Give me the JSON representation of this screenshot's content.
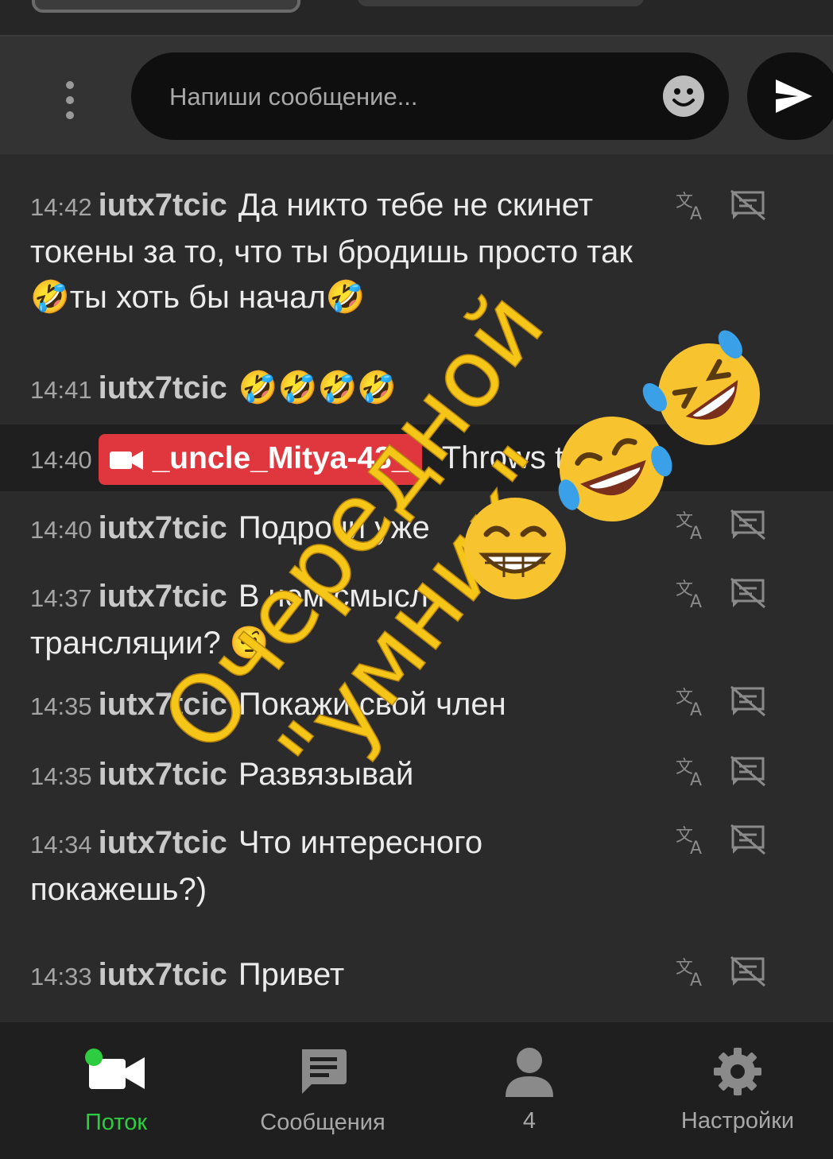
{
  "composer": {
    "placeholder": "Напиши сообщение..."
  },
  "messages": [
    {
      "time": "14:42",
      "user": "iutx7tcic",
      "text": "Да никто тебе не скинет токены за то, что ты бродишь просто так🤣ты хоть бы начал🤣"
    },
    {
      "time": "14:41",
      "user": "iutx7tcic",
      "text": "🤣🤣🤣🤣"
    },
    {
      "time": "14:40",
      "user": "_uncle_Mitya-43_",
      "text": "Throws tokens"
    },
    {
      "time": "14:40",
      "user": "iutx7tcic",
      "text": "Подрочи уже"
    },
    {
      "time": "14:37",
      "user": "iutx7tcic",
      "text": "В чем смысл трансляции? 🤨"
    },
    {
      "time": "14:35",
      "user": "iutx7tcic",
      "text": "Покажи свой член"
    },
    {
      "time": "14:35",
      "user": "iutx7tcic",
      "text": "Развязывай"
    },
    {
      "time": "14:34",
      "user": "iutx7tcic",
      "text": "Что интересного покажешь?)"
    },
    {
      "time": "14:33",
      "user": "iutx7tcic",
      "text": "Привет"
    }
  ],
  "overlay": {
    "line1": "Очередной",
    "line2": "\"умник\"",
    "color": "#f5c518"
  },
  "nav": [
    {
      "label": "Поток",
      "icon": "video-camera-icon",
      "active": true
    },
    {
      "label": "Сообщения",
      "icon": "message-icon",
      "active": false
    },
    {
      "label": "4",
      "icon": "person-icon",
      "active": false
    },
    {
      "label": "Настройки",
      "icon": "gear-icon",
      "active": false
    }
  ],
  "colors": {
    "accent": "#2ecc40",
    "badge": "#e0363d",
    "background": "#2b2b2b"
  }
}
